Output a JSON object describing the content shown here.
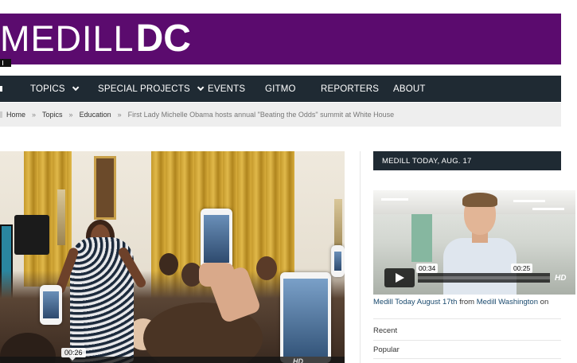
{
  "logo": {
    "part1": "MEDILL",
    "part2": "DC"
  },
  "nav": {
    "items": [
      {
        "label": "TOPICS",
        "has_dropdown": true
      },
      {
        "label": "SPECIAL PROJECTS",
        "has_dropdown": true
      },
      {
        "label": "EVENTS",
        "has_dropdown": false
      },
      {
        "label": "GITMO",
        "has_dropdown": false
      },
      {
        "label": "REPORTERS",
        "has_dropdown": false
      },
      {
        "label": "ABOUT",
        "has_dropdown": false
      }
    ]
  },
  "breadcrumb": {
    "items": [
      "Home",
      "Topics",
      "Education"
    ],
    "separator": "»",
    "current": "First Lady Michelle Obama hosts annual \"Beating the Odds\" summit at White House"
  },
  "main_video": {
    "time_tooltip": "00:26",
    "hd_label": "HD"
  },
  "sidebar": {
    "header": "MEDILL TODAY, AUG. 17",
    "video": {
      "time_current": "00:34",
      "time_total": "00:25",
      "hd_label": "HD"
    },
    "caption": {
      "title": "Medill Today August 17th",
      "from": "from",
      "source": "Medill Washington",
      "on": "on"
    },
    "tabs": [
      "Recent",
      "Popular"
    ]
  },
  "colors": {
    "banner": "#5b0b6e",
    "nav": "#1f2a33",
    "breadcrumb_bg": "#eeeeee"
  }
}
